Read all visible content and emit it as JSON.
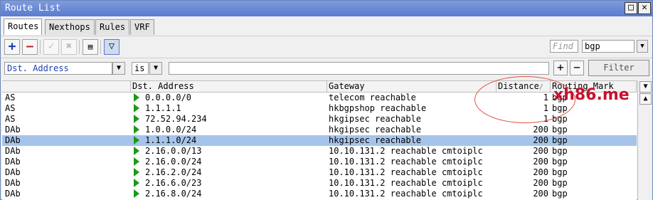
{
  "window": {
    "title": "Route List",
    "restore_icon": "restore-icon",
    "close_icon": "close-icon"
  },
  "tabs": [
    {
      "label": "Routes",
      "active": true
    },
    {
      "label": "Nexthops",
      "active": false
    },
    {
      "label": "Rules",
      "active": false
    },
    {
      "label": "VRF",
      "active": false
    }
  ],
  "toolbar": {
    "add_icon": "plus-icon",
    "remove_icon": "minus-icon",
    "enable_icon": "check-icon",
    "disable_icon": "x-icon",
    "comment_icon": "note-icon",
    "filter_icon": "funnel-icon",
    "find_placeholder": "Find",
    "search_value": "bgp"
  },
  "filter": {
    "field": "Dst. Address",
    "operator": "is",
    "value": "",
    "add_label": "+",
    "remove_label": "−",
    "filter_label": "Filter"
  },
  "columns": [
    "Dst. Address",
    "Gateway",
    "Distance",
    "Routing Mark"
  ],
  "sort_indicator": "/",
  "rows": [
    {
      "flags": "AS",
      "dst": "0.0.0.0/0",
      "gateway": "telecom reachable",
      "distance": "1",
      "mark": "bgp",
      "selected": false
    },
    {
      "flags": "AS",
      "dst": "1.1.1.1",
      "gateway": "hkbgpshop reachable",
      "distance": "1",
      "mark": "bgp",
      "selected": false
    },
    {
      "flags": "AS",
      "dst": "72.52.94.234",
      "gateway": "hkgipsec reachable",
      "distance": "1",
      "mark": "bgp",
      "selected": false
    },
    {
      "flags": "DAb",
      "dst": "1.0.0.0/24",
      "gateway": "hkgipsec reachable",
      "distance": "200",
      "mark": "bgp",
      "selected": false
    },
    {
      "flags": "DAb",
      "dst": "1.1.1.0/24",
      "gateway": "hkgipsec reachable",
      "distance": "200",
      "mark": "bgp",
      "selected": true
    },
    {
      "flags": "DAb",
      "dst": "2.16.0.0/13",
      "gateway": "10.10.131.2 reachable cmtoiplc",
      "distance": "200",
      "mark": "bgp",
      "selected": false
    },
    {
      "flags": "DAb",
      "dst": "2.16.0.0/24",
      "gateway": "10.10.131.2 reachable cmtoiplc",
      "distance": "200",
      "mark": "bgp",
      "selected": false
    },
    {
      "flags": "DAb",
      "dst": "2.16.2.0/24",
      "gateway": "10.10.131.2 reachable cmtoiplc",
      "distance": "200",
      "mark": "bgp",
      "selected": false
    },
    {
      "flags": "DAb",
      "dst": "2.16.6.0/23",
      "gateway": "10.10.131.2 reachable cmtoiplc",
      "distance": "200",
      "mark": "bgp",
      "selected": false
    },
    {
      "flags": "DAb",
      "dst": "2.16.8.0/24",
      "gateway": "10.10.131.2 reachable cmtoiplc",
      "distance": "200",
      "mark": "bgp",
      "selected": false
    }
  ],
  "watermark": "xh86.me",
  "colors": {
    "selected_row": "#a6c4ea",
    "active_flag": "#1a9a1a",
    "annotation": "#e05040",
    "watermark": "#c8102e"
  }
}
